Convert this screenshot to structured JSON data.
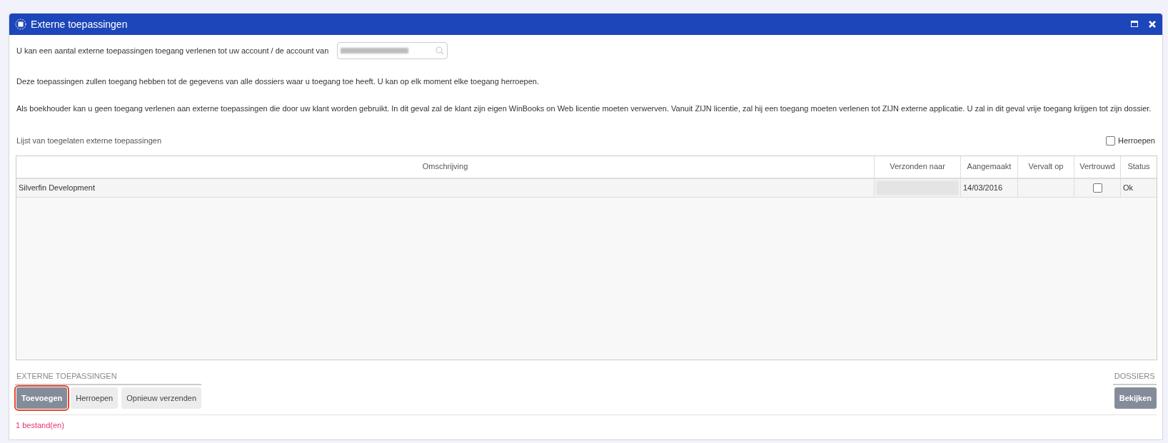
{
  "window": {
    "title": "Externe toepassingen"
  },
  "intro": "U kan een aantal externe toepassingen toegang verlenen tot uw account / de account van",
  "paragraphs": [
    "Deze toepassingen zullen toegang hebben tot de gegevens van alle dossiers waar u toegang toe heeft. U kan op elk moment elke toegang herroepen.",
    "Als boekhouder kan u geen toegang verlenen aan externe toepassingen die door uw klant worden gebruikt.  In dit geval zal de klant zijn eigen WinBooks on Web licentie moeten verwerven.  Vanuit ZIJN licentie, zal hij een toegang moeten verlenen tot ZIJN externe applicatie.  U zal in dit geval vrije toegang krijgen tot zijn dossier."
  ],
  "list_label": "Lijst van toegelaten externe toepassingen",
  "revoke_filter": {
    "label": "Herroepen",
    "checked": false
  },
  "table": {
    "columns": [
      "Omschrijving",
      "Verzonden naar",
      "Aangemaakt",
      "Vervalt op",
      "Vertrouwd",
      "Status"
    ],
    "rows": [
      {
        "description": "Silverfin Development",
        "created": "14/03/2016",
        "trusted": false,
        "status": "Ok"
      }
    ]
  },
  "groups": [
    {
      "label": "EXTERNE TOEPASSINGEN",
      "buttons": [
        {
          "label": "Toevoegen",
          "primary": true,
          "focused": true
        },
        {
          "label": "Herroepen",
          "primary": false,
          "focused": false
        },
        {
          "label": "Opnieuw verzenden",
          "primary": false,
          "focused": false
        }
      ]
    },
    {
      "label": "DOSSIERS",
      "buttons": [
        {
          "label": "Bekijken",
          "primary": true,
          "focused": false
        }
      ]
    }
  ],
  "status_bar": "1 bestand(en)"
}
